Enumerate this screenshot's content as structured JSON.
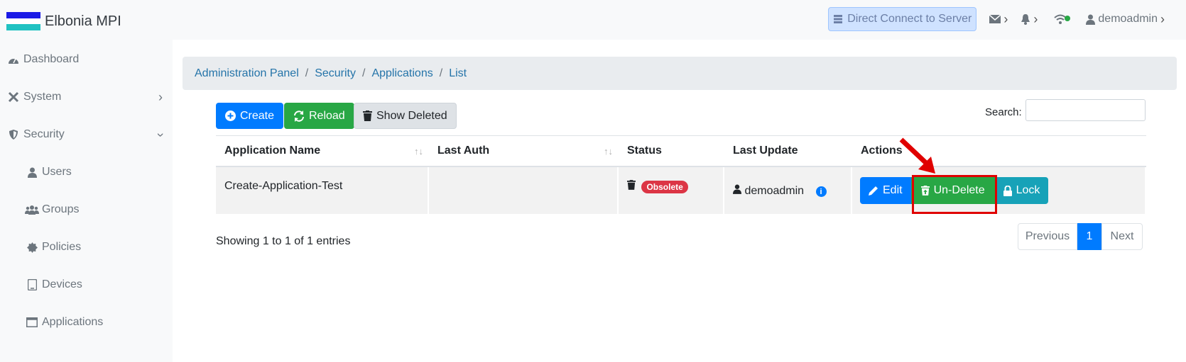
{
  "app": {
    "title": "Elbonia MPI",
    "flag_colors": [
      "#1a1ae6",
      "#ffffff",
      "#21c2c2"
    ]
  },
  "header": {
    "direct_connect_label": "Direct Connect to Server",
    "user_name": "demoadmin",
    "wifi_status_color": "#28a745"
  },
  "sidebar": {
    "items": [
      {
        "label": "Dashboard",
        "icon": "tachometer-icon"
      },
      {
        "label": "System",
        "icon": "tools-icon"
      },
      {
        "label": "Security",
        "icon": "shield-icon"
      },
      {
        "label": "Users",
        "icon": "user-icon"
      },
      {
        "label": "Groups",
        "icon": "users-icon"
      },
      {
        "label": "Policies",
        "icon": "certificate-icon"
      },
      {
        "label": "Devices",
        "icon": "tablet-icon"
      },
      {
        "label": "Applications",
        "icon": "window-icon"
      }
    ]
  },
  "breadcrumb": [
    "Administration Panel",
    "Security",
    "Applications",
    "List"
  ],
  "toolbar": {
    "create_label": "Create",
    "reload_label": "Reload",
    "show_deleted_label": "Show Deleted",
    "search_label": "Search:",
    "search_value": ""
  },
  "table": {
    "columns": [
      "Application Name",
      "Last Auth",
      "Status",
      "Last Update",
      "Actions"
    ],
    "rows": [
      {
        "name": "Create-Application-Test",
        "last_auth": "",
        "status_badge": "Obsolete",
        "last_update_user": "demoadmin",
        "actions": [
          "Edit",
          "Un-Delete",
          "Lock"
        ]
      }
    ]
  },
  "footer": {
    "info": "Showing 1 to 1 of 1 entries",
    "pagination": [
      "Previous",
      "1",
      "Next"
    ]
  }
}
